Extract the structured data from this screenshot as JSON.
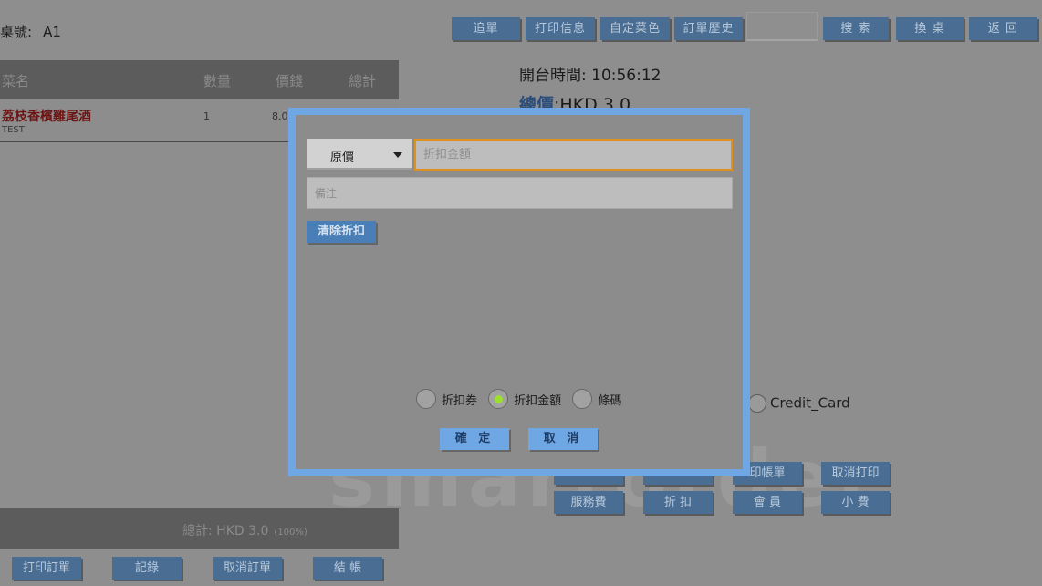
{
  "header": {
    "table_label": "桌號:",
    "table_value": "A1"
  },
  "toolbar": {
    "add_order": "追單",
    "print_info": "打印信息",
    "custom_dish": "自定菜色",
    "order_history": "訂單歷史",
    "search_value": "",
    "search": "搜 索",
    "change_table": "換 桌",
    "back": "返 回"
  },
  "order_table": {
    "columns": [
      "菜名",
      "數量",
      "價錢",
      "總計"
    ],
    "rows": [
      {
        "name": "荔枝香檳雞尾酒",
        "sub": "TEST",
        "qty": "1",
        "price": "8.0"
      }
    ]
  },
  "summary": {
    "total_label": "總計: HKD 3.0",
    "total_pct": "(100%)"
  },
  "bottom_actions": {
    "print_order": "打印訂單",
    "records": "記錄",
    "cancel_order": "取消訂單",
    "checkout": "結 帳"
  },
  "info": {
    "open_time": "開台時間: 10:56:12",
    "total_label": "總價",
    "total_value": ":HKD 3.0"
  },
  "payment": {
    "credit_card": "Credit_Card"
  },
  "watermark": "smartorder",
  "actions": {
    "print_bill": "印帳單",
    "cancel_print": "取消打印",
    "service_fee": "服務費",
    "discount": "折 扣",
    "member": "會 員",
    "tips": "小 費"
  },
  "dialog": {
    "mode_selected": "原價",
    "amount_placeholder": "折扣金額",
    "remark_placeholder": "備注",
    "clear_discount": "清除折扣",
    "radio_options": [
      {
        "label": "折扣券",
        "selected": false
      },
      {
        "label": "折扣金額",
        "selected": true
      },
      {
        "label": "條碼",
        "selected": false
      }
    ],
    "confirm": "確 定",
    "cancel": "取 消"
  },
  "colors": {
    "button_blue": "#4a6e93",
    "dialog_border": "#6fa6e4",
    "input_focus": "#e0901e",
    "radio_on": "#9be02e"
  }
}
